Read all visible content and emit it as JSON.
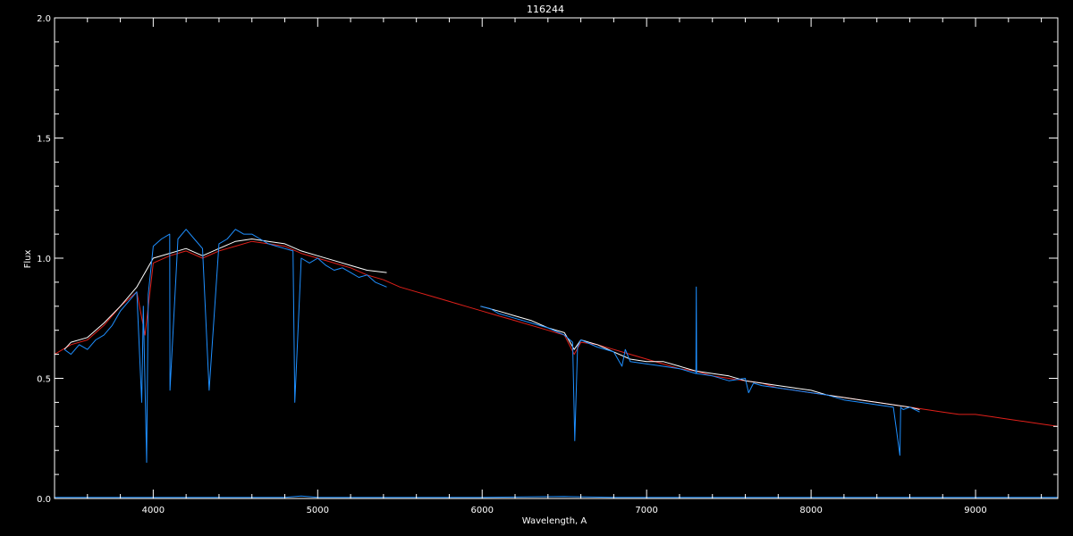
{
  "chart_data": {
    "type": "line",
    "title": "116244",
    "xlabel": "Wavelength, A",
    "ylabel": "Flux",
    "xlim": [
      3400,
      9500
    ],
    "ylim": [
      0.0,
      2.0
    ],
    "x_ticks": [
      4000,
      5000,
      6000,
      7000,
      8000,
      9000
    ],
    "y_ticks": [
      0.0,
      0.5,
      1.0,
      1.5,
      2.0
    ],
    "y_tick_labels": [
      "0.0",
      "0.5",
      "1.0",
      "1.5",
      "2.0"
    ],
    "grid": false,
    "colors": {
      "background": "#000000",
      "axes": "#ffffff",
      "model": "#e0201a",
      "observed_white": "#ffffff",
      "observed_blue": "#1e8fff"
    },
    "series": [
      {
        "color": "#e0201a",
        "x": [
          3400,
          3500,
          3600,
          3700,
          3800,
          3900,
          3950,
          4000,
          4100,
          4200,
          4300,
          4400,
          4500,
          4600,
          4700,
          4800,
          4900,
          5000,
          5100,
          5200,
          5300,
          5400,
          5500,
          5600,
          5700,
          5800,
          5900,
          6000,
          6100,
          6200,
          6300,
          6400,
          6500,
          6560,
          6600,
          6700,
          6800,
          6900,
          7000,
          7100,
          7200,
          7300,
          7400,
          7500,
          7600,
          7700,
          7800,
          7900,
          8000,
          8100,
          8200,
          8300,
          8400,
          8500,
          8600,
          8700,
          8800,
          8900,
          9000,
          9100,
          9200,
          9300,
          9400,
          9500
        ],
        "y": [
          0.6,
          0.64,
          0.66,
          0.72,
          0.8,
          0.86,
          0.68,
          0.98,
          1.01,
          1.03,
          1.0,
          1.03,
          1.05,
          1.07,
          1.06,
          1.05,
          1.02,
          1.0,
          0.98,
          0.96,
          0.93,
          0.91,
          0.88,
          0.86,
          0.84,
          0.82,
          0.8,
          0.78,
          0.76,
          0.74,
          0.72,
          0.7,
          0.68,
          0.6,
          0.65,
          0.64,
          0.62,
          0.6,
          0.58,
          0.56,
          0.54,
          0.53,
          0.51,
          0.5,
          0.49,
          0.48,
          0.46,
          0.45,
          0.44,
          0.43,
          0.42,
          0.41,
          0.4,
          0.39,
          0.38,
          0.37,
          0.36,
          0.35,
          0.35,
          0.34,
          0.33,
          0.32,
          0.31,
          0.3
        ]
      },
      {
        "color": "#ffffff",
        "x": [
          3460,
          3500,
          3600,
          3700,
          3800,
          3900,
          4000,
          4100,
          4200,
          4300,
          4400,
          4500,
          4600,
          4700,
          4800,
          4900,
          5000,
          5100,
          5200,
          5300,
          5420
        ],
        "y": [
          0.62,
          0.65,
          0.67,
          0.73,
          0.8,
          0.88,
          1.0,
          1.02,
          1.04,
          1.01,
          1.04,
          1.07,
          1.08,
          1.07,
          1.06,
          1.03,
          1.01,
          0.99,
          0.97,
          0.95,
          0.94
        ]
      },
      {
        "color": "#ffffff",
        "x": [
          5990,
          6100,
          6200,
          6300,
          6400,
          6500,
          6560,
          6600,
          6700,
          6800,
          6900,
          7000,
          7100,
          7200,
          7300,
          7400,
          7500,
          7600,
          7700,
          7800,
          7900,
          8000,
          8100,
          8200,
          8300,
          8400,
          8500,
          8600,
          8660
        ],
        "y": [
          0.8,
          0.78,
          0.76,
          0.74,
          0.71,
          0.69,
          0.62,
          0.66,
          0.64,
          0.61,
          0.58,
          0.57,
          0.57,
          0.55,
          0.53,
          0.52,
          0.51,
          0.49,
          0.48,
          0.47,
          0.46,
          0.45,
          0.43,
          0.42,
          0.41,
          0.4,
          0.39,
          0.38,
          0.37
        ]
      },
      {
        "color": "#1e8fff",
        "x": [
          3460,
          3500,
          3550,
          3600,
          3650,
          3700,
          3750,
          3800,
          3850,
          3900,
          3930,
          3940,
          3960,
          3970,
          4000,
          4050,
          4100,
          4102,
          4150,
          4200,
          4250,
          4300,
          4340,
          4400,
          4450,
          4500,
          4550,
          4600,
          4650,
          4700,
          4750,
          4800,
          4850,
          4861,
          4900,
          4950,
          5000,
          5050,
          5100,
          5150,
          5200,
          5250,
          5300,
          5350,
          5420
        ],
        "y": [
          0.62,
          0.6,
          0.64,
          0.62,
          0.66,
          0.68,
          0.72,
          0.78,
          0.82,
          0.86,
          0.4,
          0.8,
          0.15,
          0.85,
          1.05,
          1.08,
          1.1,
          0.45,
          1.08,
          1.12,
          1.08,
          1.04,
          0.45,
          1.06,
          1.08,
          1.12,
          1.1,
          1.1,
          1.08,
          1.06,
          1.05,
          1.04,
          1.03,
          0.4,
          1.0,
          0.98,
          1.0,
          0.97,
          0.95,
          0.96,
          0.94,
          0.92,
          0.93,
          0.9,
          0.88
        ]
      },
      {
        "color": "#1e8fff",
        "x": [
          5990,
          6050,
          6100,
          6200,
          6300,
          6400,
          6500,
          6550,
          6563,
          6580,
          6600,
          6700,
          6800,
          6850,
          6870,
          6900,
          7000,
          7100,
          7200,
          7300,
          7302,
          7304,
          7400,
          7500,
          7600,
          7620,
          7650,
          7700,
          7800,
          7900,
          8000,
          8100,
          8200,
          8300,
          8400,
          8500,
          8540,
          8545,
          8560,
          8600,
          8660
        ],
        "y": [
          0.8,
          0.79,
          0.77,
          0.75,
          0.73,
          0.71,
          0.68,
          0.65,
          0.24,
          0.63,
          0.66,
          0.63,
          0.61,
          0.55,
          0.62,
          0.57,
          0.56,
          0.55,
          0.54,
          0.52,
          0.88,
          0.52,
          0.51,
          0.49,
          0.5,
          0.44,
          0.48,
          0.47,
          0.46,
          0.45,
          0.44,
          0.43,
          0.41,
          0.4,
          0.39,
          0.38,
          0.18,
          0.38,
          0.37,
          0.38,
          0.36
        ]
      },
      {
        "color": "#1e8fff",
        "x": [
          3400,
          4800,
          4900,
          5000,
          6000,
          6500,
          6800,
          9500
        ],
        "y": [
          0.005,
          0.005,
          0.01,
          0.005,
          0.005,
          0.008,
          0.005,
          0.005
        ]
      }
    ]
  }
}
